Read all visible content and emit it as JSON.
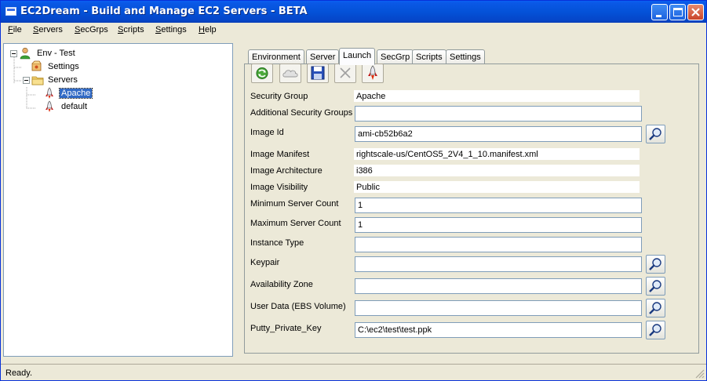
{
  "window": {
    "title": "EC2Dream - Build and Manage EC2 Servers - BETA"
  },
  "menubar": {
    "items": [
      {
        "label": "File",
        "key": "F",
        "rest": "ile"
      },
      {
        "label": "Servers",
        "key": "S",
        "rest": "ervers"
      },
      {
        "label": "SecGrps",
        "key": "S",
        "rest": "ecGrps"
      },
      {
        "label": "Scripts",
        "key": "S",
        "rest": "cripts"
      },
      {
        "label": "Settings",
        "key": "S",
        "rest": "ettings"
      },
      {
        "label": "Help",
        "key": "H",
        "rest": "elp"
      }
    ]
  },
  "tree": {
    "nodes": [
      {
        "label": "Env - Test",
        "icon": "user-icon"
      },
      {
        "label": "Settings",
        "icon": "settings-icon"
      },
      {
        "label": "Servers",
        "icon": "folder-icon"
      },
      {
        "label": "Apache",
        "icon": "rocket-icon",
        "selected": true
      },
      {
        "label": "default",
        "icon": "rocket-icon"
      }
    ]
  },
  "tabs": [
    {
      "label": "Environment"
    },
    {
      "label": "Server"
    },
    {
      "label": "Launch",
      "active": true
    },
    {
      "label": "SecGrp"
    },
    {
      "label": "Scripts"
    },
    {
      "label": "Settings"
    }
  ],
  "toolbar": {
    "buttons": [
      {
        "icon": "refresh-icon",
        "enabled": true
      },
      {
        "icon": "cloud-icon",
        "enabled": false
      },
      {
        "icon": "save-icon",
        "enabled": true
      },
      {
        "icon": "delete-icon",
        "enabled": false
      },
      {
        "icon": "launch-rocket-icon",
        "enabled": true
      }
    ]
  },
  "form": {
    "security_group": {
      "label": "Security Group",
      "value": "Apache"
    },
    "additional_security_groups": {
      "label": "Additional Security Groups",
      "value": ""
    },
    "image_id": {
      "label": "Image Id",
      "value": "ami-cb52b6a2"
    },
    "image_manifest": {
      "label": "Image Manifest",
      "value": "rightscale-us/CentOS5_2V4_1_10.manifest.xml"
    },
    "image_architecture": {
      "label": "Image Architecture",
      "value": "i386"
    },
    "image_visibility": {
      "label": "Image Visibility",
      "value": "Public"
    },
    "minimum_server_count": {
      "label": "Minimum Server Count",
      "value": "1"
    },
    "maximum_server_count": {
      "label": "Maximum Server Count",
      "value": "1"
    },
    "instance_type": {
      "label": "Instance Type",
      "value": ""
    },
    "keypair": {
      "label": "Keypair",
      "value": ""
    },
    "availability_zone": {
      "label": "Availability Zone",
      "value": ""
    },
    "user_data": {
      "label": "User Data (EBS Volume)",
      "value": ""
    },
    "putty_private_key": {
      "label": "Putty_Private_Key",
      "value": "C:\\ec2\\test\\test.ppk"
    }
  },
  "status": {
    "text": "Ready."
  },
  "colors": {
    "titlebar": "#0452d8",
    "selection": "#316ac5",
    "face": "#ece9d8"
  }
}
